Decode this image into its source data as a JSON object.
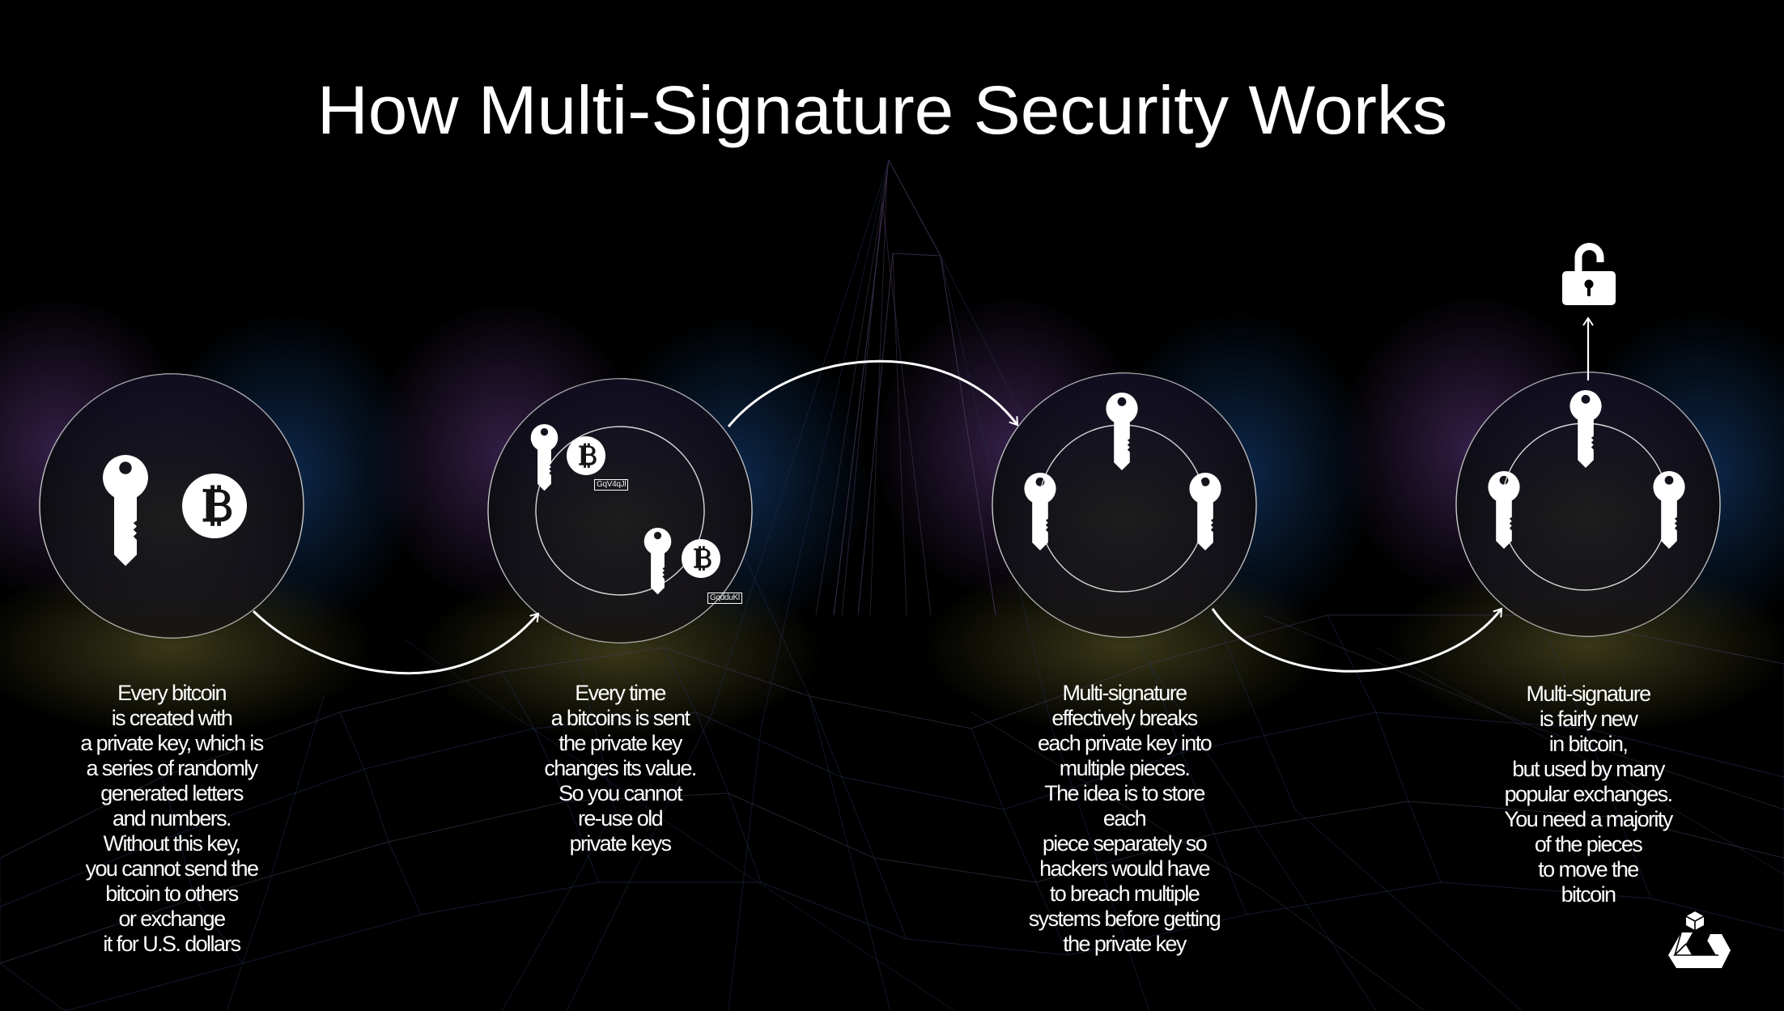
{
  "title": "How Multi-Signature Security Works",
  "colors": {
    "background": "#000000",
    "foreground": "#ffffff",
    "circle_fill": "#131218",
    "glow_purple": "#3a2450",
    "glow_blue": "#0d2a4e",
    "glow_olive": "#3a3a18",
    "mesh_blue": "#243258",
    "mesh_purple": "#4a3a5e"
  },
  "steps": [
    {
      "id": "single-key",
      "icons": [
        "key-icon",
        "bitcoin-icon"
      ],
      "caption": "Every bitcoin\nis created with\na private key, which is\na series of randomly\ngenerated letters\nand numbers.\nWithout this key,\nyou cannot send the\nbitcoin to others\nor exchange\nit for U.S. dollars"
    },
    {
      "id": "changing-key",
      "icons": [
        "key-icon",
        "bitcoin-icon",
        "key-icon",
        "bitcoin-icon"
      ],
      "key_labels": [
        "GqV4qJl",
        "GqdduKl"
      ],
      "caption": "Every time\na bitcoins is sent\nthe private key\nchanges its value.\nSo you cannot\nre-use old\nprivate keys"
    },
    {
      "id": "split-key",
      "icons": [
        "key-icon",
        "key-icon",
        "key-icon"
      ],
      "caption": "Multi-signature\neffectively breaks\neach private key into\nmultiple pieces.\nThe idea is to store\neach\npiece separately so\nhackers would have\nto breach multiple\nsystems before getting\nthe private key"
    },
    {
      "id": "majority-unlock",
      "icons": [
        "key-icon",
        "key-icon",
        "key-icon",
        "unlock-icon"
      ],
      "caption": "Multi-signature\nis fairly new\nin bitcoin,\nbut used by many\npopular exchanges.\nYou need a majority\nof the pieces\nto move the\nbitcoin"
    }
  ],
  "logo": "brand-logo-icon"
}
